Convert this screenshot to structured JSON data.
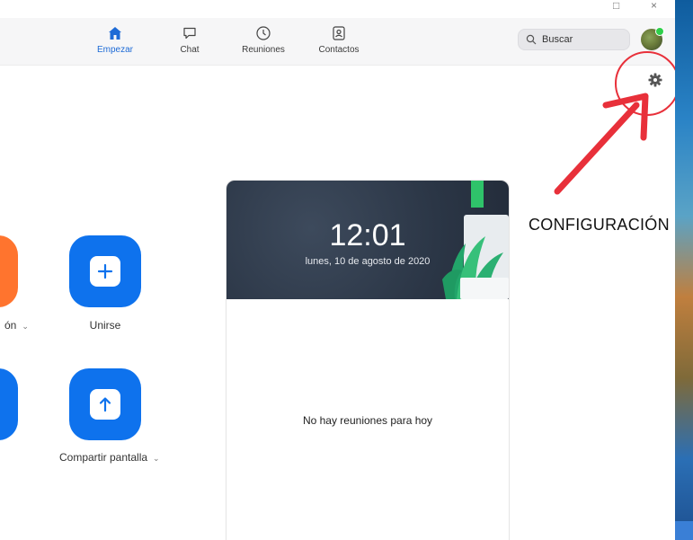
{
  "toolbar": {
    "tabs": [
      {
        "label": "Empezar",
        "icon": "home-icon",
        "active": true
      },
      {
        "label": "Chat",
        "icon": "chat-icon",
        "active": false
      },
      {
        "label": "Reuniones",
        "icon": "clock-icon",
        "active": false
      },
      {
        "label": "Contactos",
        "icon": "contacts-icon",
        "active": false
      }
    ],
    "search_placeholder": "Buscar"
  },
  "actions": [
    {
      "label": "ón",
      "color": "#ff742e",
      "icon": "video-icon",
      "has_dropdown": true
    },
    {
      "label": "Unirse",
      "color": "#0e72ed",
      "icon": "plus-icon",
      "has_dropdown": false
    },
    {
      "label": "",
      "color": "#0e72ed",
      "icon": "calendar-icon",
      "has_dropdown": false
    },
    {
      "label": "Compartir pantalla",
      "color": "#0e72ed",
      "icon": "share-up-arrow-icon",
      "has_dropdown": true
    }
  ],
  "meeting_card": {
    "time": "12:01",
    "date": "lunes, 10 de agosto de 2020",
    "empty_message": "No hay reuniones para hoy"
  },
  "annotation": {
    "label": "CONFIGURACIÓN",
    "color": "#e8303a"
  },
  "colors": {
    "accent": "#0e72ed",
    "orange": "#ff742e",
    "card_header": "#2b3646"
  }
}
